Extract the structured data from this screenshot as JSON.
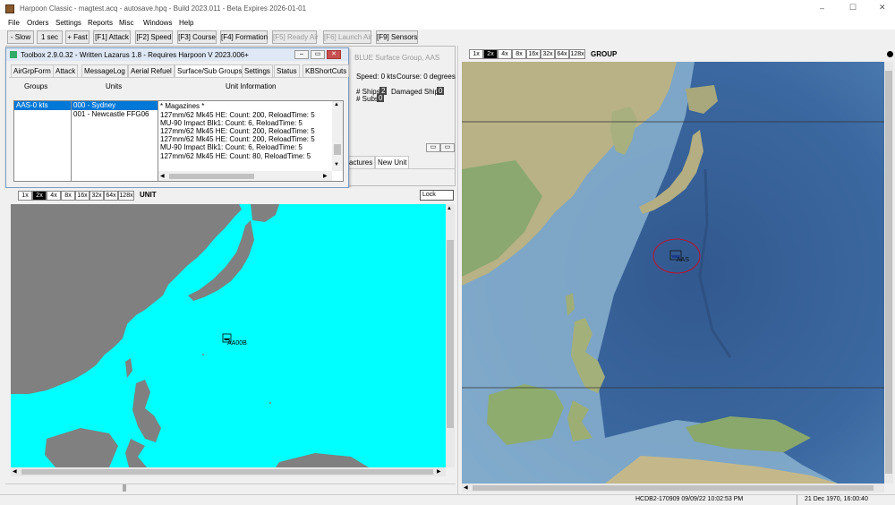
{
  "title_bar": {
    "title": "Harpoon Classic - magtest.acq - autosave.hpq - Build 2023.011 - Beta Expires 2026-01-01",
    "min_icon": "–",
    "max_icon": "☐",
    "close_icon": "✕"
  },
  "menu": [
    "File",
    "Orders",
    "Settings",
    "Reports",
    "Misc",
    "Windows",
    "Help"
  ],
  "toolbar": [
    "- Slow",
    "1 sec",
    "+ Fast",
    "[F1] Attack",
    "[F2] Speed",
    "[F3] Course",
    "[F4] Formation",
    "[F5] Ready Air",
    "[F6] Launch Air",
    "[F9] Sensors"
  ],
  "toolbox": {
    "title": "Toolbox 2.9.0.32 - Written Lazarus 1.8 - Requires Harpoon V 2023.006+",
    "tabs": [
      "AirGrpForm",
      "Attack",
      "MessageLog",
      "Aerial Refuel",
      "Surface/Sub Groups",
      "Settings",
      "Status",
      "KBShortCuts"
    ],
    "col_groups": "Groups",
    "col_units": "Units",
    "col_info": "Unit Information",
    "groups": [
      "AAS-0 kts"
    ],
    "units": [
      "000 - Sydney",
      "001 - Newcastle FFG06"
    ],
    "info": [
      "* Magazines *",
      "127mm/62 Mk45 HE: Count: 200, ReloadTime: 5",
      "MU-90 Impact Blk1: Count: 6, ReloadTime: 5",
      "127mm/62 Mk45 HE: Count: 200, ReloadTime: 5",
      "127mm/62 Mk45 HE: Count: 200, ReloadTime: 5",
      "MU-90 Impact Blk1: Count: 6, ReloadTime: 5",
      "127mm/62 Mk45 HE: Count: 80, ReloadTime: 5"
    ],
    "scroll_up": "▲",
    "scroll_down": "▼",
    "scroll_left": "◀",
    "scroll_right": "▶"
  },
  "group_info": {
    "title": "BLUE Surface Group, AAS",
    "speed": "Speed: 0 kts",
    "course": "Course: 0 degrees",
    "ships_label": "# Ships",
    "ships": "2",
    "damaged_label": "Damaged Ships",
    "damaged": "0",
    "subs_label": "# Subs",
    "subs": "0",
    "tabs": [
      "actures",
      "New Unit"
    ]
  },
  "unit_map": {
    "zooms": [
      "1x",
      "2x",
      "4x",
      "8x",
      "16x",
      "32x",
      "64x",
      "128x"
    ],
    "selected_zoom": "2x",
    "label": "UNIT",
    "lock": "Lock",
    "unit_label": "AA00B"
  },
  "group_map": {
    "zooms": [
      "1x",
      "2x",
      "4x",
      "8x",
      "16x",
      "32x",
      "64x",
      "128x"
    ],
    "selected_zoom": "2x",
    "label": "GROUP",
    "unit_label": "AAS"
  },
  "status_bar": {
    "db": "HCDB2-170909 09/09/22 10:02:53 PM",
    "datetime": "21 Dec 1970, 16:00:40"
  },
  "colors": {
    "sea": "#00ffff",
    "land": "#808080",
    "selected": "#0078d7"
  }
}
